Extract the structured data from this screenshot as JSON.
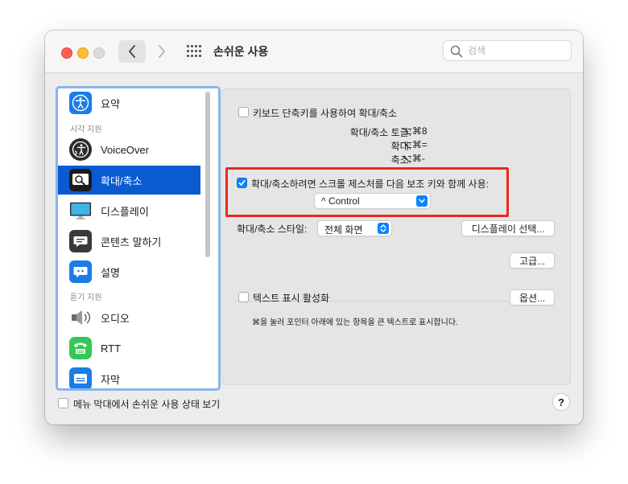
{
  "window": {
    "title": "손쉬운 사용"
  },
  "search": {
    "placeholder": "검색",
    "value": ""
  },
  "sidebar": {
    "items": [
      {
        "label": "요약",
        "icon": "accessibility-icon"
      },
      {
        "section": "시각 지원"
      },
      {
        "label": "VoiceOver",
        "icon": "voiceover-icon"
      },
      {
        "label": "확대/축소",
        "icon": "zoom-icon",
        "selected": true
      },
      {
        "label": "디스플레이",
        "icon": "display-icon"
      },
      {
        "label": "콘텐츠 말하기",
        "icon": "speech-bubble-icon"
      },
      {
        "label": "설명",
        "icon": "descriptions-icon"
      },
      {
        "section": "듣기 지원"
      },
      {
        "label": "오디오",
        "icon": "speaker-icon"
      },
      {
        "label": "RTT",
        "icon": "rtt-phone-icon"
      },
      {
        "label": "자막",
        "icon": "captions-icon"
      }
    ]
  },
  "zoom": {
    "keyboard_shortcuts_label": "키보드 단축키를 사용하여 확대/축소",
    "keyboard_shortcuts_checked": false,
    "shortcuts": [
      {
        "name": "확대/축소 토글:",
        "keys": "⌥⌘8"
      },
      {
        "name": "확대:",
        "keys": "⌥⌘="
      },
      {
        "name": "축소:",
        "keys": "⌥⌘-"
      }
    ],
    "scroll_gesture_label": "확대/축소하려면 스크롤 제스처를 다음 보조 키와 함께 사용:",
    "scroll_gesture_checked": true,
    "modifier_value": "^ Control",
    "style_label": "확대/축소 스타일:",
    "style_value": "전체 화면",
    "display_select_button": "디스플레이 선택...",
    "advanced_button": "고급...",
    "hover_text_label": "텍스트 표시 활성화",
    "hover_text_checked": false,
    "options_button": "옵션...",
    "hover_text_hint": "⌘을 눌러 포인터 아래에 있는 항목을 큰 텍스트로 표시합니다."
  },
  "footer": {
    "menu_bar_status_label": "메뉴 막대에서 손쉬운 사용 상태 보기",
    "menu_bar_status_checked": false,
    "help_label": "?"
  },
  "colors": {
    "accent": "#0a84ff",
    "selection": "#0a5bd1",
    "highlight_border": "#e8291c"
  }
}
